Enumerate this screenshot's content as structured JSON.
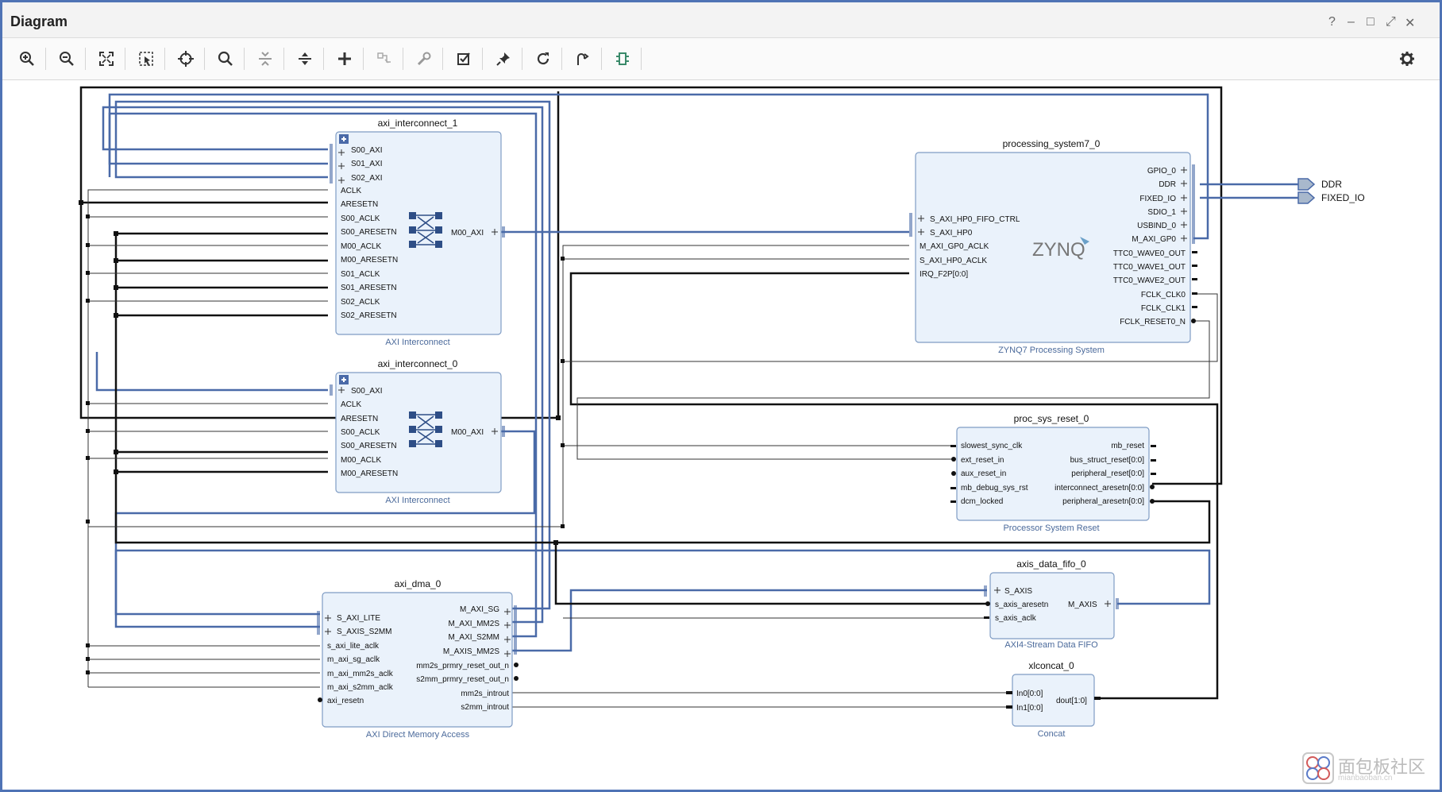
{
  "window": {
    "title": "Diagram",
    "controls": {
      "help": "?",
      "minimize": "–",
      "maximize": "□",
      "restore": "⤢",
      "close": "✕"
    }
  },
  "toolbar": {
    "icons": [
      "zoom-in-icon",
      "zoom-out-icon",
      "fit-view-icon",
      "fit-selection-icon",
      "center-icon",
      "search-icon",
      "collapse-all-icon",
      "expand-all-icon",
      "add-ip-icon",
      "make-connection-icon",
      "run-automation-icon",
      "validate-icon",
      "pin-icon",
      "regenerate-layout-icon",
      "optimize-routing-icon",
      "create-port-icon",
      "settings-icon"
    ]
  },
  "colors": {
    "bus": "#4a6aa8",
    "wire": "#111111",
    "block_fill": "#eaf2fb",
    "block_border": "#7f9cc4",
    "label_blue": "#4b6a9b"
  },
  "blocks": [
    {
      "id": "axi_interconnect_1",
      "name": "axi_interconnect_1",
      "subtitle": "AXI Interconnect",
      "left_ports": [
        "S00_AXI",
        "S01_AXI",
        "S02_AXI",
        "ACLK",
        "ARESETN",
        "S00_ACLK",
        "S00_ARESETN",
        "M00_ACLK",
        "M00_ARESETN",
        "S01_ACLK",
        "S01_ARESETN",
        "S02_ACLK",
        "S02_ARESETN"
      ],
      "right_ports": [
        "M00_AXI"
      ]
    },
    {
      "id": "axi_interconnect_0",
      "name": "axi_interconnect_0",
      "subtitle": "AXI Interconnect",
      "left_ports": [
        "S00_AXI",
        "ACLK",
        "ARESETN",
        "S00_ACLK",
        "S00_ARESETN",
        "M00_ACLK",
        "M00_ARESETN"
      ],
      "right_ports": [
        "M00_AXI"
      ]
    },
    {
      "id": "axi_dma_0",
      "name": "axi_dma_0",
      "subtitle": "AXI Direct Memory Access",
      "left_ports": [
        "S_AXI_LITE",
        "S_AXIS_S2MM",
        "s_axi_lite_aclk",
        "m_axi_sg_aclk",
        "m_axi_mm2s_aclk",
        "m_axi_s2mm_aclk",
        "axi_resetn"
      ],
      "right_ports": [
        "M_AXI_SG",
        "M_AXI_MM2S",
        "M_AXI_S2MM",
        "M_AXIS_MM2S",
        "mm2s_prmry_reset_out_n",
        "s2mm_prmry_reset_out_n",
        "mm2s_introut",
        "s2mm_introut"
      ]
    },
    {
      "id": "processing_system7_0",
      "name": "processing_system7_0",
      "subtitle": "ZYNQ7 Processing System",
      "logo": "ZYNQ",
      "left_ports": [
        "S_AXI_HP0_FIFO_CTRL",
        "S_AXI_HP0",
        "M_AXI_GP0_ACLK",
        "S_AXI_HP0_ACLK",
        "IRQ_F2P[0:0]"
      ],
      "right_ports": [
        "GPIO_0",
        "DDR",
        "FIXED_IO",
        "SDIO_1",
        "USBIND_0",
        "M_AXI_GP0",
        "TTC0_WAVE0_OUT",
        "TTC0_WAVE1_OUT",
        "TTC0_WAVE2_OUT",
        "FCLK_CLK0",
        "FCLK_CLK1",
        "FCLK_RESET0_N"
      ]
    },
    {
      "id": "proc_sys_reset_0",
      "name": "proc_sys_reset_0",
      "subtitle": "Processor System Reset",
      "left_ports": [
        "slowest_sync_clk",
        "ext_reset_in",
        "aux_reset_in",
        "mb_debug_sys_rst",
        "dcm_locked"
      ],
      "right_ports": [
        "mb_reset",
        "bus_struct_reset[0:0]",
        "peripheral_reset[0:0]",
        "interconnect_aresetn[0:0]",
        "peripheral_aresetn[0:0]"
      ]
    },
    {
      "id": "axis_data_fifo_0",
      "name": "axis_data_fifo_0",
      "subtitle": "AXI4-Stream Data FIFO",
      "left_ports": [
        "S_AXIS",
        "s_axis_aresetn",
        "s_axis_aclk"
      ],
      "right_ports": [
        "M_AXIS"
      ]
    },
    {
      "id": "xlconcat_0",
      "name": "xlconcat_0",
      "subtitle": "Concat",
      "left_ports": [
        "In0[0:0]",
        "In1[0:0]"
      ],
      "right_ports": [
        "dout[1:0]"
      ]
    }
  ],
  "external_ports": [
    "DDR",
    "FIXED_IO"
  ],
  "watermark": {
    "text": "面包板社区",
    "sub": "mianbaoban.cn"
  }
}
